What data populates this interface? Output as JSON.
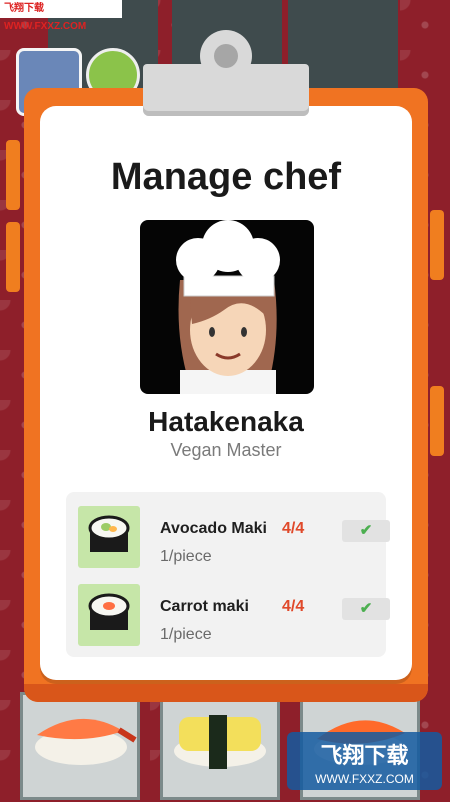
{
  "watermark": {
    "top_text": "飞翔下载 WWW.FXXZ.COM",
    "logo_big": "飞翔下载",
    "logo_small": "WWW.FXXZ.COM"
  },
  "dialog": {
    "title": "Manage chef",
    "chef": {
      "name": "Hatakenaka",
      "title": "Vegan Master",
      "portrait_icon": "chef-portrait"
    },
    "recipes": [
      {
        "name": "Avocado Maki",
        "count": "4/4",
        "price": "1/piece",
        "icon": "avocado-maki-icon",
        "check": "✔"
      },
      {
        "name": "Carrot maki",
        "count": "4/4",
        "price": "1/piece",
        "icon": "carrot-maki-icon",
        "check": "✔"
      }
    ]
  },
  "colors": {
    "board": "#f07322",
    "background": "#8e1f2a",
    "count": "#e0492a",
    "check": "#4caf50",
    "thumb": "#c6e6a8"
  }
}
